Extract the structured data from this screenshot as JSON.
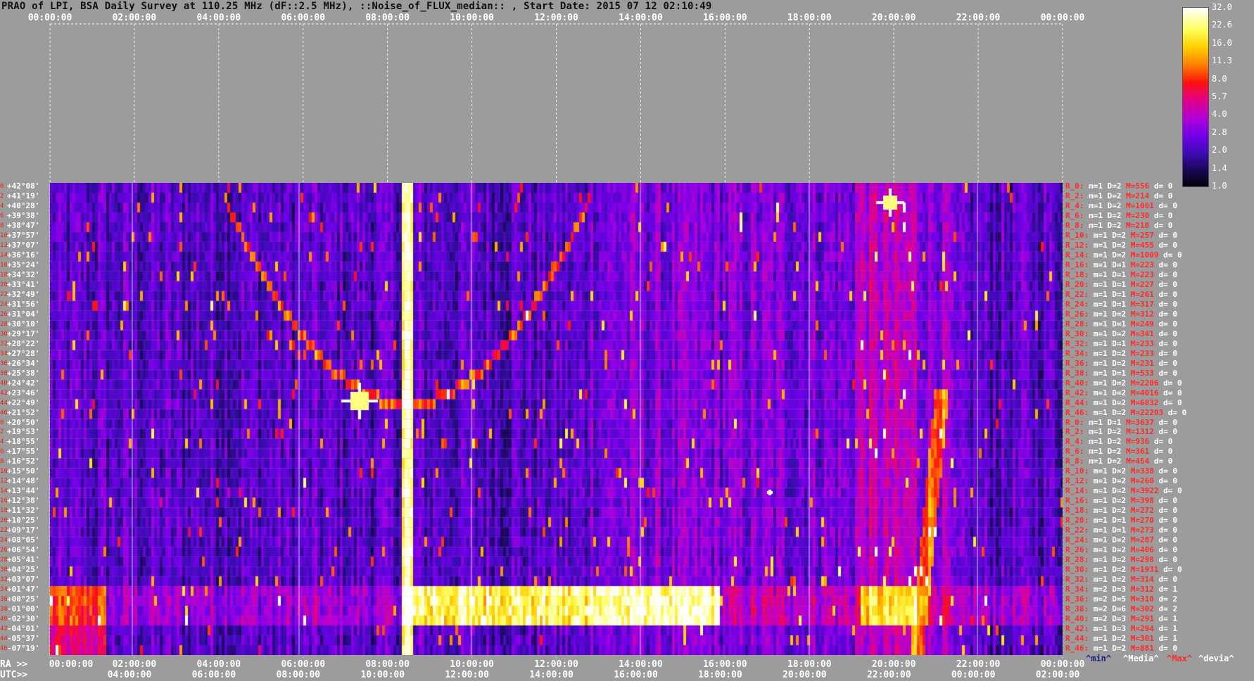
{
  "title": "PRAO of LPI, BSA Daily Survey at 110.25 MHz (dF::2.5 MHz), ::Noise_of_FLUX_median:: , Start Date: 2015 07 12 02:10:49",
  "top_ticks": [
    "00:00:00",
    "02:00:00",
    "04:00:00",
    "06:00:00",
    "08:00:00",
    "10:00:00",
    "12:00:00",
    "14:00:00",
    "16:00:00",
    "18:00:00",
    "20:00:00",
    "22:00:00",
    "00:00:00"
  ],
  "ra_axis_label": "RA >>",
  "utc_axis_label": "UTC>>",
  "ra_ticks": [
    "00:00:00",
    "02:00:00",
    "04:00:00",
    "06:00:00",
    "08:00:00",
    "10:00:00",
    "12:00:00",
    "14:00:00",
    "16:00:00",
    "18:00:00",
    "20:00:00",
    "22:00:00",
    "00:00:00"
  ],
  "utc_ticks": [
    "04:00:00",
    "06:00:00",
    "08:00:00",
    "10:00:00",
    "12:00:00",
    "14:00:00",
    "16:00:00",
    "18:00:00",
    "20:00:00",
    "22:00:00",
    "00:00:00",
    "02:00:00"
  ],
  "colorbar_ticks": [
    "32.0",
    "22.6",
    "16.0",
    "11.3",
    "8.0",
    "5.7",
    "4.0",
    "2.8",
    "2.0",
    "1.4",
    "1.0"
  ],
  "legend": {
    "min": "^min^",
    "median": "^Media^",
    "max": "^Max^",
    "devia": "^devia^"
  },
  "colors": {
    "background": "#9c9c9c",
    "stat_label": "#ff2a2a",
    "stat_value": "#ffffff",
    "legend_min": "#202080",
    "legend_max": "#ff2a2a"
  },
  "chart_data": {
    "type": "heatmap",
    "title": "PRAO of LPI, BSA Daily Survey at 110.25 MHz (dF::2.5 MHz), ::Noise_of_FLUX_median:: , Start Date: 2015 07 12 02:10:49",
    "x_axis": {
      "label": "RA",
      "range": [
        "00:00:00",
        "00:00:00"
      ]
    },
    "color_scale": {
      "min": 1.0,
      "max": 32.0,
      "scale": "log2"
    },
    "rows": [
      {
        "idx": "0",
        "dec": "+42°08'",
        "beam": "R_0:",
        "m": "1",
        "d1": "2",
        "M": "556",
        "d2": "0"
      },
      {
        "idx": "2",
        "dec": "+41°19'",
        "beam": "R_2:",
        "m": "1",
        "d1": "2",
        "M": "214",
        "d2": "0"
      },
      {
        "idx": "4",
        "dec": "+40°28'",
        "beam": "R_4:",
        "m": "1",
        "d1": "2",
        "M": "1061",
        "d2": "0"
      },
      {
        "idx": "6",
        "dec": "+39°38'",
        "beam": "R_6:",
        "m": "1",
        "d1": "2",
        "M": "230",
        "d2": "0"
      },
      {
        "idx": "8",
        "dec": "+38°47'",
        "beam": "R_8:",
        "m": "1",
        "d1": "2",
        "M": "218",
        "d2": "0"
      },
      {
        "idx": "10",
        "dec": "+37°57'",
        "beam": "R_10:",
        "m": "1",
        "d1": "2",
        "M": "257",
        "d2": "0"
      },
      {
        "idx": "12",
        "dec": "+37°07'",
        "beam": "R_12:",
        "m": "1",
        "d1": "2",
        "M": "455",
        "d2": "0"
      },
      {
        "idx": "14",
        "dec": "+36°16'",
        "beam": "R_14:",
        "m": "1",
        "d1": "2",
        "M": "1009",
        "d2": "0"
      },
      {
        "idx": "16",
        "dec": "+35°24'",
        "beam": "R_16:",
        "m": "1",
        "d1": "1",
        "M": "223",
        "d2": "0"
      },
      {
        "idx": "18",
        "dec": "+34°32'",
        "beam": "R_18:",
        "m": "1",
        "d1": "1",
        "M": "223",
        "d2": "0"
      },
      {
        "idx": "20",
        "dec": "+33°41'",
        "beam": "R_20:",
        "m": "1",
        "d1": "1",
        "M": "227",
        "d2": "0"
      },
      {
        "idx": "22",
        "dec": "+32°49'",
        "beam": "R_22:",
        "m": "1",
        "d1": "1",
        "M": "261",
        "d2": "0"
      },
      {
        "idx": "24",
        "dec": "+31°56'",
        "beam": "R_24:",
        "m": "1",
        "d1": "1",
        "M": "317",
        "d2": "0"
      },
      {
        "idx": "26",
        "dec": "+31°04'",
        "beam": "R_26:",
        "m": "1",
        "d1": "2",
        "M": "312",
        "d2": "0"
      },
      {
        "idx": "28",
        "dec": "+30°10'",
        "beam": "R_28:",
        "m": "1",
        "d1": "1",
        "M": "249",
        "d2": "0"
      },
      {
        "idx": "30",
        "dec": "+29°17'",
        "beam": "R_30:",
        "m": "1",
        "d1": "2",
        "M": "341",
        "d2": "0"
      },
      {
        "idx": "32",
        "dec": "+28°22'",
        "beam": "R_32:",
        "m": "1",
        "d1": "1",
        "M": "233",
        "d2": "0"
      },
      {
        "idx": "34",
        "dec": "+27°28'",
        "beam": "R_34:",
        "m": "1",
        "d1": "2",
        "M": "233",
        "d2": "0"
      },
      {
        "idx": "36",
        "dec": "+26°34'",
        "beam": "R_36:",
        "m": "1",
        "d1": "2",
        "M": "231",
        "d2": "0"
      },
      {
        "idx": "38",
        "dec": "+25°38'",
        "beam": "R_38:",
        "m": "1",
        "d1": "1",
        "M": "533",
        "d2": "0"
      },
      {
        "idx": "40",
        "dec": "+24°42'",
        "beam": "R_40:",
        "m": "1",
        "d1": "2",
        "M": "2206",
        "d2": "0"
      },
      {
        "idx": "42",
        "dec": "+23°46'",
        "beam": "R_42:",
        "m": "1",
        "d1": "2",
        "M": "4016",
        "d2": "0"
      },
      {
        "idx": "44",
        "dec": "+22°49'",
        "beam": "R_44:",
        "m": "1",
        "d1": "2",
        "M": "6832",
        "d2": "0"
      },
      {
        "idx": "46",
        "dec": "+21°52'",
        "beam": "R_46:",
        "m": "1",
        "d1": "2",
        "M": "22203",
        "d2": "0"
      },
      {
        "idx": "0",
        "dec": "+20°50'",
        "beam": "R_0:",
        "m": "1",
        "d1": "1",
        "M": "3637",
        "d2": "0"
      },
      {
        "idx": "2",
        "dec": "+19°53'",
        "beam": "R_2:",
        "m": "1",
        "d1": "2",
        "M": "1312",
        "d2": "0"
      },
      {
        "idx": "4",
        "dec": "+18°55'",
        "beam": "R_4:",
        "m": "1",
        "d1": "2",
        "M": "936",
        "d2": "0"
      },
      {
        "idx": "6",
        "dec": "+17°55'",
        "beam": "R_6:",
        "m": "1",
        "d1": "2",
        "M": "361",
        "d2": "0"
      },
      {
        "idx": "8",
        "dec": "+16°52'",
        "beam": "R_8:",
        "m": "1",
        "d1": "2",
        "M": "454",
        "d2": "0"
      },
      {
        "idx": "10",
        "dec": "+15°50'",
        "beam": "R_10:",
        "m": "1",
        "d1": "2",
        "M": "338",
        "d2": "0"
      },
      {
        "idx": "12",
        "dec": "+14°48'",
        "beam": "R_12:",
        "m": "1",
        "d1": "2",
        "M": "260",
        "d2": "0"
      },
      {
        "idx": "14",
        "dec": "+13°44'",
        "beam": "R_14:",
        "m": "1",
        "d1": "2",
        "M": "3922",
        "d2": "0"
      },
      {
        "idx": "16",
        "dec": "+12°38'",
        "beam": "R_16:",
        "m": "1",
        "d1": "2",
        "M": "398",
        "d2": "0"
      },
      {
        "idx": "18",
        "dec": "+11°32'",
        "beam": "R_18:",
        "m": "1",
        "d1": "2",
        "M": "272",
        "d2": "0"
      },
      {
        "idx": "20",
        "dec": "+10°25'",
        "beam": "R_20:",
        "m": "1",
        "d1": "1",
        "M": "270",
        "d2": "0"
      },
      {
        "idx": "22",
        "dec": "+09°17'",
        "beam": "R_22:",
        "m": "1",
        "d1": "1",
        "M": "273",
        "d2": "0"
      },
      {
        "idx": "24",
        "dec": "+08°05'",
        "beam": "R_24:",
        "m": "1",
        "d1": "2",
        "M": "287",
        "d2": "0"
      },
      {
        "idx": "26",
        "dec": "+06°54'",
        "beam": "R_26:",
        "m": "1",
        "d1": "2",
        "M": "406",
        "d2": "0"
      },
      {
        "idx": "28",
        "dec": "+05°41'",
        "beam": "R_28:",
        "m": "1",
        "d1": "2",
        "M": "298",
        "d2": "0"
      },
      {
        "idx": "30",
        "dec": "+04°25'",
        "beam": "R_30:",
        "m": "1",
        "d1": "2",
        "M": "1931",
        "d2": "0"
      },
      {
        "idx": "32",
        "dec": "+03°07'",
        "beam": "R_32:",
        "m": "1",
        "d1": "2",
        "M": "314",
        "d2": "0"
      },
      {
        "idx": "34",
        "dec": "+01°47'",
        "beam": "R_34:",
        "m": "2",
        "d1": "3",
        "M": "312",
        "d2": "1"
      },
      {
        "idx": "36",
        "dec": "+00°25'",
        "beam": "R_36:",
        "m": "2",
        "d1": "5",
        "M": "310",
        "d2": "2"
      },
      {
        "idx": "38",
        "dec": "-01°00'",
        "beam": "R_38:",
        "m": "2",
        "d1": "6",
        "M": "302",
        "d2": "2"
      },
      {
        "idx": "40",
        "dec": "-02°30'",
        "beam": "R_40:",
        "m": "2",
        "d1": "3",
        "M": "291",
        "d2": "1"
      },
      {
        "idx": "42",
        "dec": "-04°01'",
        "beam": "R_42:",
        "m": "1",
        "d1": "3",
        "M": "294",
        "d2": "1"
      },
      {
        "idx": "44",
        "dec": "-05°37'",
        "beam": "R_44:",
        "m": "1",
        "d1": "2",
        "M": "301",
        "d2": "1"
      },
      {
        "idx": "46",
        "dec": "-07°19'",
        "beam": "R_46:",
        "m": "1",
        "d1": "2",
        "M": "881",
        "d2": "0"
      }
    ]
  }
}
